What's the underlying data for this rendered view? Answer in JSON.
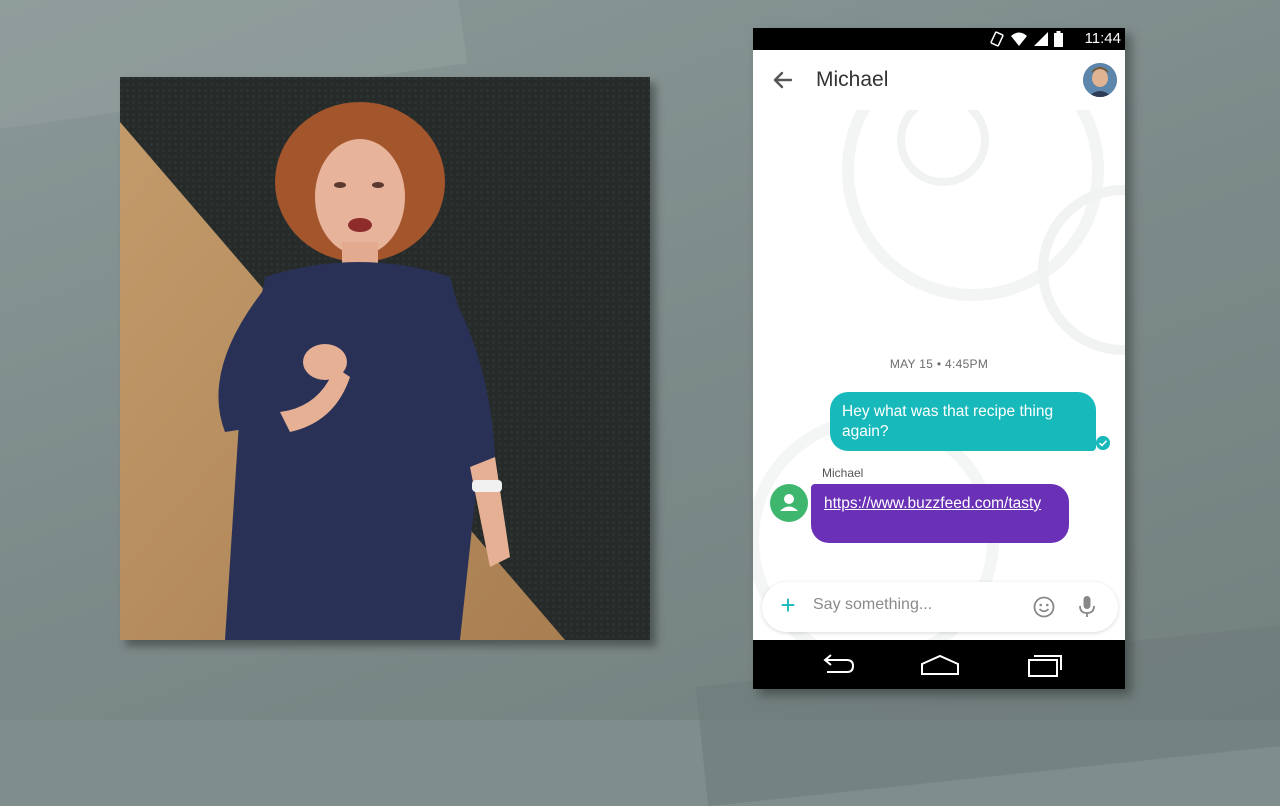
{
  "status_bar": {
    "time": "11:44"
  },
  "conversation": {
    "contact_name": "Michael",
    "date_divider": "MAY 15 • 4:45PM",
    "outgoing_message": "Hey what was that recipe thing again?",
    "incoming_sender": "Michael",
    "incoming_link": "https://www.buzzfeed.com/tasty"
  },
  "composer": {
    "placeholder": "Say something..."
  },
  "icons": [
    "back-arrow-icon",
    "contact-avatar-icon",
    "add-icon",
    "emoji-icon",
    "mic-icon",
    "nav-back-icon",
    "nav-home-icon",
    "nav-recents-icon",
    "wifi-icon",
    "battery-icon",
    "signal-icon",
    "rotate-icon"
  ],
  "colors": {
    "accent": "#17b9bb",
    "incoming_bubble": "#6a31b6",
    "avatar_green": "#3fb66e",
    "background": "#7f8d8c"
  }
}
